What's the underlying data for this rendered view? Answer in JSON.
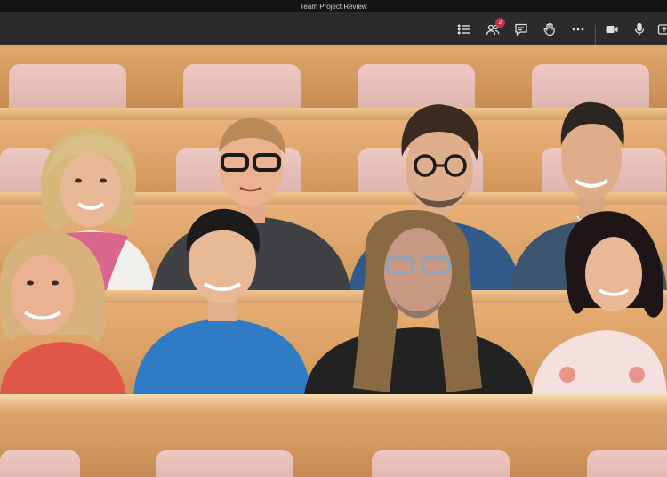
{
  "window": {
    "title": "Team Project Review"
  },
  "toolbar": {
    "participants_badge": "2"
  },
  "icons": {
    "list": "list-icon",
    "participants": "people-icon",
    "chat": "chat-icon",
    "raise_hand": "hand-icon",
    "more": "more-icon",
    "camera": "camera-icon",
    "mic": "microphone-icon",
    "share": "share-icon"
  },
  "colors": {
    "titlebar": "#141414",
    "toolbar": "#2b2b2b",
    "badge": "#c4314b",
    "seat": "#e8c0ba",
    "wood": "#d7a06a"
  }
}
